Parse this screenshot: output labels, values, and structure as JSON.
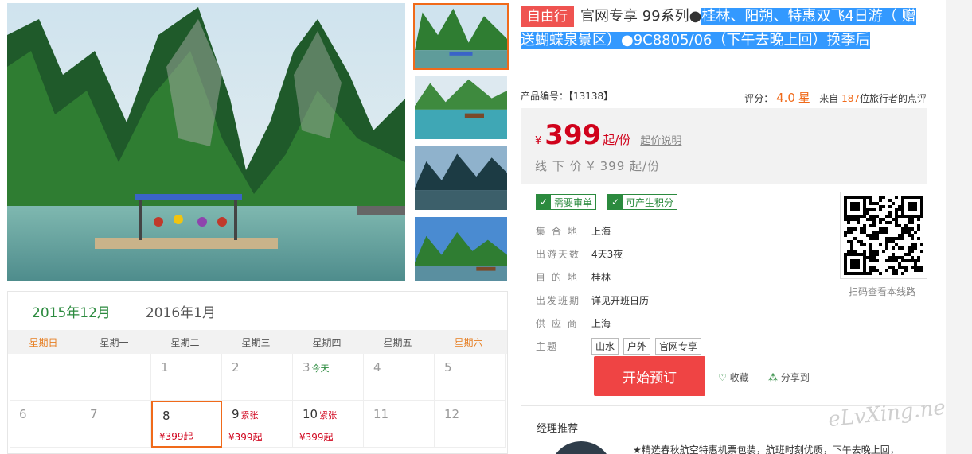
{
  "product": {
    "badge": "自由行",
    "title_prefix": "官网专享 99系列●",
    "title_highlight": "桂林、阳朔、特惠双飞4日游（ 赠送蝴蝶泉景区）●9C8805/06（下午去晚上回）换季后",
    "code_label": "产品编号：【13138】",
    "rating_label": "评分：",
    "rating_value": "4.0",
    "rating_unit": "星",
    "review_prefix": "来自",
    "review_count": "187",
    "review_suffix": "位旅行者的点评"
  },
  "price": {
    "currency": "¥",
    "value": "399",
    "unit": "起/份",
    "explain_link": "起价说明",
    "offline": "线 下 价  ¥ 399 起/份"
  },
  "checks": [
    "需要审单",
    "可产生积分"
  ],
  "info": {
    "rows": [
      {
        "k": "集 合 地",
        "v": "上海"
      },
      {
        "k": "出游天数",
        "v": "4天3夜"
      },
      {
        "k": "目 的 地",
        "v": "桂林"
      },
      {
        "k": "出发班期",
        "v": "详见开班日历"
      },
      {
        "k": "供 应 商",
        "v": "上海"
      }
    ],
    "theme_label": "主题",
    "themes": [
      "山水",
      "户外",
      "官网专享"
    ]
  },
  "qr_caption": "扫码查看本线路",
  "actions": {
    "book": "开始预订",
    "favorite": "收藏",
    "share": "分享到"
  },
  "manager": {
    "title": "经理推荐",
    "text": "★精选春秋航空特惠机票包装，航班时刻优质，下午去晚上回，"
  },
  "calendar": {
    "months": [
      "2015年12月",
      "2016年1月"
    ],
    "weekdays": [
      "星期日",
      "星期一",
      "星期二",
      "星期三",
      "星期四",
      "星期五",
      "星期六"
    ],
    "rows": [
      [
        {
          "d": ""
        },
        {
          "d": ""
        },
        {
          "d": "1"
        },
        {
          "d": "2"
        },
        {
          "d": "3",
          "tag": "今天"
        },
        {
          "d": "4"
        },
        {
          "d": "5"
        }
      ],
      [
        {
          "d": "6"
        },
        {
          "d": "7"
        },
        {
          "d": "8",
          "price": "¥399起",
          "sel": true
        },
        {
          "d": "9",
          "tag": "紧张",
          "price": "¥399起"
        },
        {
          "d": "10",
          "tag": "紧张",
          "price": "¥399起"
        },
        {
          "d": "11"
        },
        {
          "d": "12"
        }
      ]
    ]
  },
  "watermark": "eLvXing.net",
  "colors": {
    "accent": "#ef4444",
    "price": "#d0021b",
    "green": "#2b8a3e",
    "highlight": "#3399ff"
  }
}
